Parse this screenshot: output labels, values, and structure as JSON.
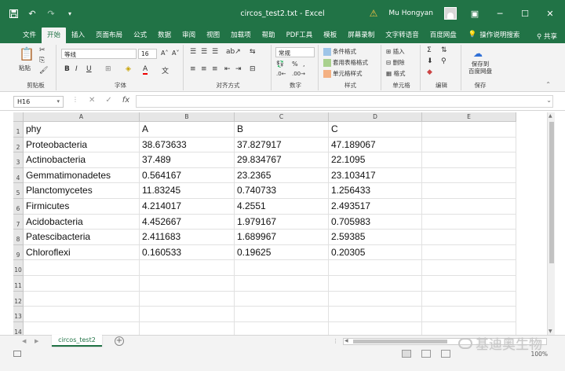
{
  "window": {
    "title": "circos_test2.txt  -  Excel",
    "user": "Mu Hongyan"
  },
  "tabs": [
    {
      "label": "文件"
    },
    {
      "label": "开始"
    },
    {
      "label": "插入"
    },
    {
      "label": "页面布局"
    },
    {
      "label": "公式"
    },
    {
      "label": "数据"
    },
    {
      "label": "审阅"
    },
    {
      "label": "视图"
    },
    {
      "label": "加载项"
    },
    {
      "label": "帮助"
    },
    {
      "label": "PDF工具"
    },
    {
      "label": "模板"
    },
    {
      "label": "屏幕录制"
    },
    {
      "label": "文字转语音"
    },
    {
      "label": "百度网盘"
    }
  ],
  "help_search": "操作说明搜索",
  "share": "共享",
  "ribbon": {
    "clipboard": {
      "label": "剪贴板",
      "paste": "粘贴"
    },
    "font": {
      "label": "字体",
      "name": "等线",
      "size": "16"
    },
    "alignment": {
      "label": "对齐方式"
    },
    "number": {
      "label": "数字",
      "format": "常规"
    },
    "styles": {
      "label": "样式",
      "conditional": "条件格式",
      "table": "套用表格格式",
      "cell": "单元格样式"
    },
    "cells": {
      "label": "单元格",
      "insert": "插入",
      "delete": "删除",
      "format": "格式"
    },
    "editing": {
      "label": "编辑"
    },
    "save": {
      "label": "保存",
      "button": "保存到\n百度网盘"
    }
  },
  "formula_bar": {
    "name_box": "H16",
    "fx": "fx",
    "value": ""
  },
  "columns": [
    "A",
    "B",
    "C",
    "D",
    "E"
  ],
  "rows": [
    {
      "num": "1",
      "cells": [
        "phy",
        "A",
        "B",
        "C",
        ""
      ]
    },
    {
      "num": "2",
      "cells": [
        "Proteobacteria",
        "38.673633",
        "37.827917",
        "47.189067",
        ""
      ]
    },
    {
      "num": "3",
      "cells": [
        "Actinobacteria",
        "37.489",
        "29.834767",
        "22.1095",
        ""
      ]
    },
    {
      "num": "4",
      "cells": [
        "Gemmatimonadetes",
        "0.564167",
        "23.2365",
        "23.103417",
        ""
      ]
    },
    {
      "num": "5",
      "cells": [
        "Planctomycetes",
        "11.83245",
        "0.740733",
        "1.256433",
        ""
      ]
    },
    {
      "num": "6",
      "cells": [
        "Firmicutes",
        "4.214017",
        "4.2551",
        "2.493517",
        ""
      ]
    },
    {
      "num": "7",
      "cells": [
        "Acidobacteria",
        "4.452667",
        "1.979167",
        "0.705983",
        ""
      ]
    },
    {
      "num": "8",
      "cells": [
        "Patescibacteria",
        "2.411683",
        "1.689967",
        "2.59385",
        ""
      ]
    },
    {
      "num": "9",
      "cells": [
        "Chloroflexi",
        "0.160533",
        "0.19625",
        "0.20305",
        ""
      ]
    },
    {
      "num": "10",
      "cells": [
        "",
        "",
        "",
        "",
        ""
      ]
    },
    {
      "num": "11",
      "cells": [
        "",
        "",
        "",
        "",
        ""
      ]
    },
    {
      "num": "12",
      "cells": [
        "",
        "",
        "",
        "",
        ""
      ]
    },
    {
      "num": "13",
      "cells": [
        "",
        "",
        "",
        "",
        ""
      ]
    },
    {
      "num": "14",
      "cells": [
        "",
        "",
        "",
        "",
        ""
      ]
    }
  ],
  "sheet_tab": "circos_test2",
  "zoom": "100%",
  "watermark": "基迪奥生物",
  "colors": {
    "accent": "#217346"
  }
}
